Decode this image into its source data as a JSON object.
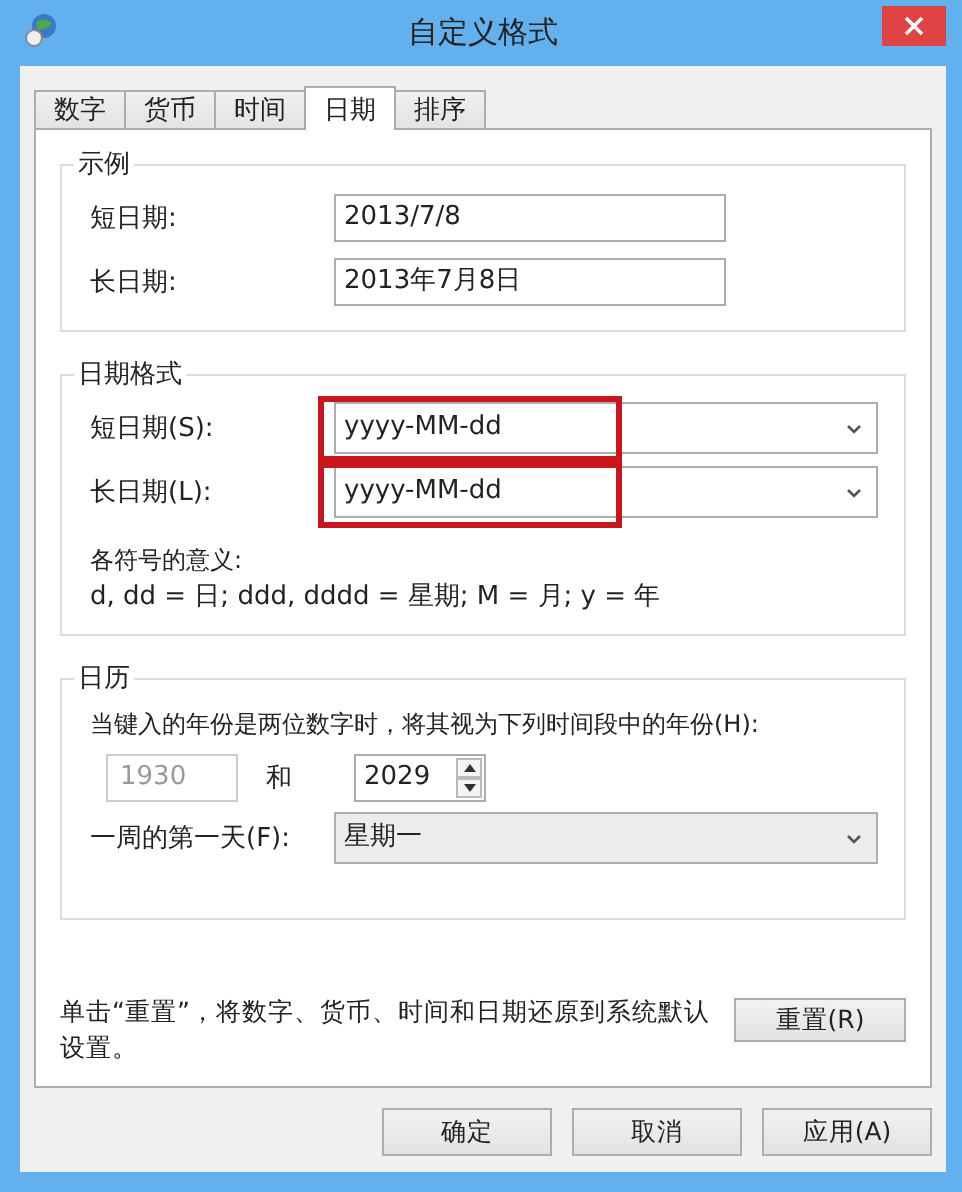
{
  "window": {
    "title": "自定义格式"
  },
  "tabs": [
    {
      "label": "数字",
      "selected": false
    },
    {
      "label": "货币",
      "selected": false
    },
    {
      "label": "时间",
      "selected": false
    },
    {
      "label": "日期",
      "selected": true
    },
    {
      "label": "排序",
      "selected": false
    }
  ],
  "example": {
    "title": "示例",
    "fields": [
      {
        "label": "短日期:",
        "value": "2013/7/8"
      },
      {
        "label": "长日期:",
        "value": "2013年7月8日"
      }
    ]
  },
  "date_format": {
    "title": "日期格式",
    "fields": [
      {
        "label": "短日期(S):",
        "value": "yyyy-MM-dd",
        "highlighted": true
      },
      {
        "label": "长日期(L):",
        "value": "yyyy-MM-dd",
        "highlighted": true
      }
    ],
    "legend_title": "各符号的意义:",
    "legend": "d, dd = 日;  ddd, dddd = 星期;  M = 月;  y = 年"
  },
  "calendar": {
    "title": "日历",
    "description": "当键入的年份是两位数字时，将其视为下列时间段中的年份(H):",
    "from_year": {
      "value": "1930",
      "disabled": true
    },
    "and_label": "和",
    "to_year": {
      "value": "2029",
      "disabled": false
    },
    "first_day": {
      "label": "一周的第一天(F):",
      "value": "星期一"
    }
  },
  "reset_note": "单击“重置”，将数字、货币、时间和日期还原到系统默认设置。",
  "reset_button": "重置(R)",
  "buttons": [
    "确定",
    "取消",
    "应用(A)"
  ]
}
